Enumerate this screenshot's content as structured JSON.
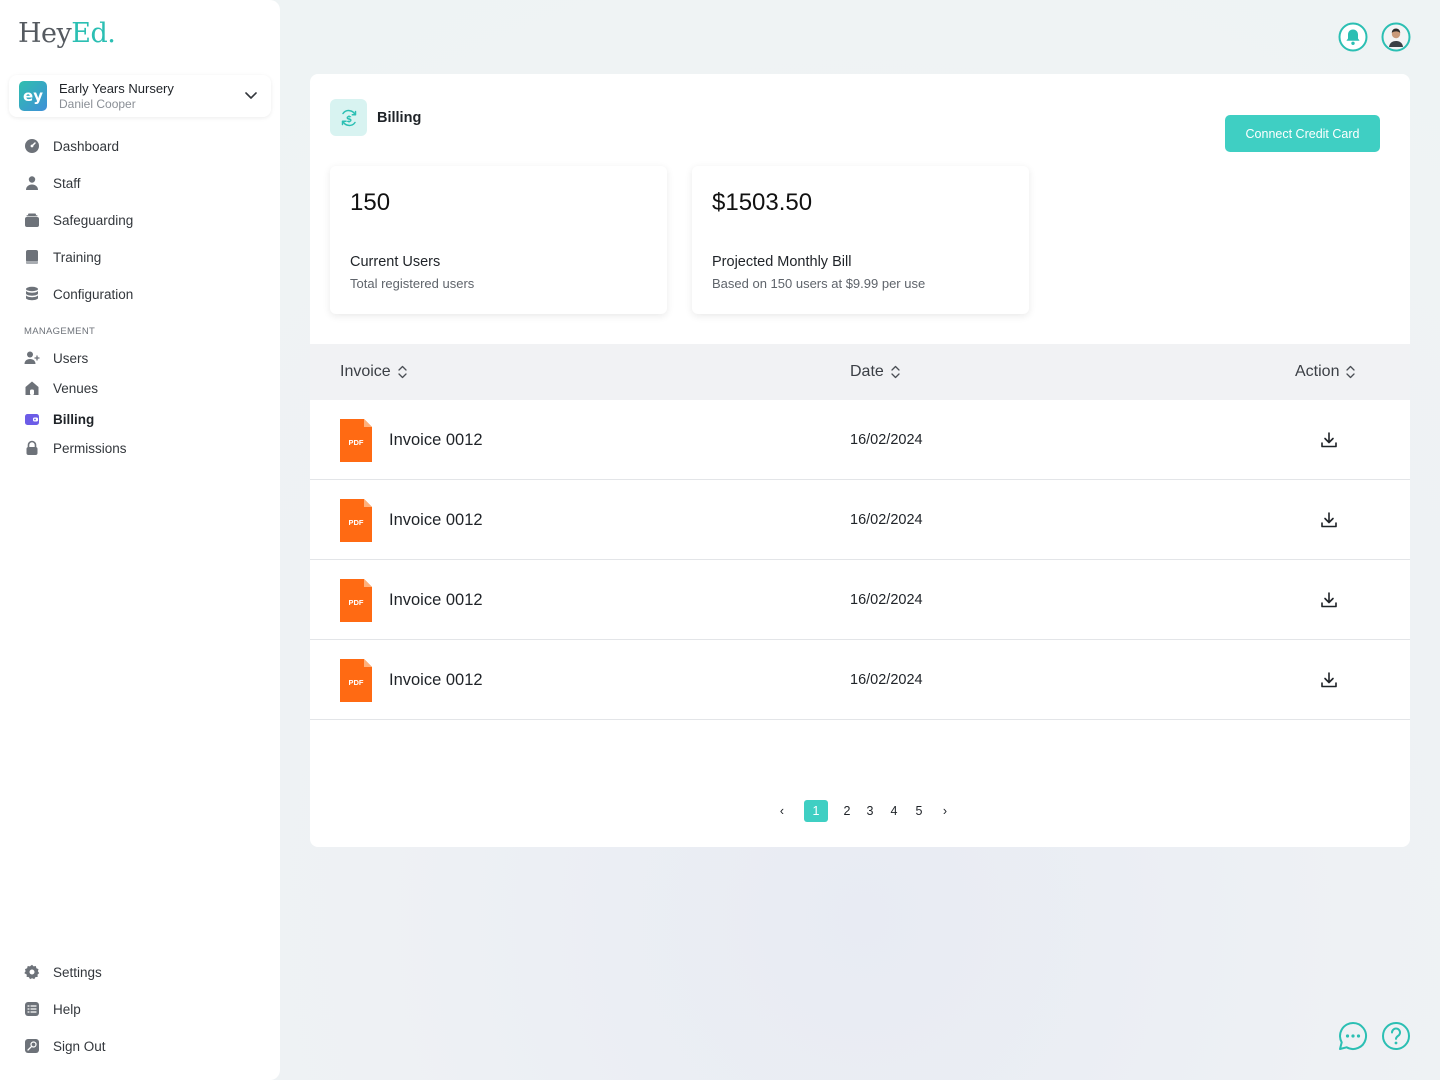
{
  "brand": {
    "logo_main": "Hey",
    "logo_accent": "Ed."
  },
  "org": {
    "badge": "ey",
    "name": "Early Years Nursery",
    "user": "Daniel Cooper"
  },
  "nav": {
    "dashboard": "Dashboard",
    "staff": "Staff",
    "safeguarding": "Safeguarding",
    "training": "Training",
    "configuration": "Configuration",
    "section_label": "MANAGEMENT",
    "users": "Users",
    "venues": "Venues",
    "billing": "Billing",
    "permissions": "Permissions",
    "settings": "Settings",
    "help": "Help",
    "signout": "Sign Out"
  },
  "page": {
    "title": "Billing",
    "connect_button": "Connect Credit Card"
  },
  "stats": {
    "users": {
      "value": "150",
      "label": "Current Users",
      "sub": "Total registered users"
    },
    "bill": {
      "value": "$1503.50",
      "label": "Projected Monthly Bill",
      "sub": "Based on 150 users at $9.99 per use"
    }
  },
  "table": {
    "headers": {
      "invoice": "Invoice",
      "date": "Date",
      "action": "Action"
    },
    "pdf_label": "PDF",
    "rows": [
      {
        "name": "Invoice 0012",
        "date": "16/02/2024"
      },
      {
        "name": "Invoice 0012",
        "date": "16/02/2024"
      },
      {
        "name": "Invoice 0012",
        "date": "16/02/2024"
      },
      {
        "name": "Invoice 0012",
        "date": "16/02/2024"
      }
    ]
  },
  "pagination": {
    "prev": "‹",
    "pages": [
      "1",
      "2",
      "3",
      "4",
      "5"
    ],
    "next": "›",
    "current": "1"
  },
  "colors": {
    "accent": "#3fcfc3",
    "pdf": "#ff6a13",
    "nav_active": "#6c5ce7"
  }
}
